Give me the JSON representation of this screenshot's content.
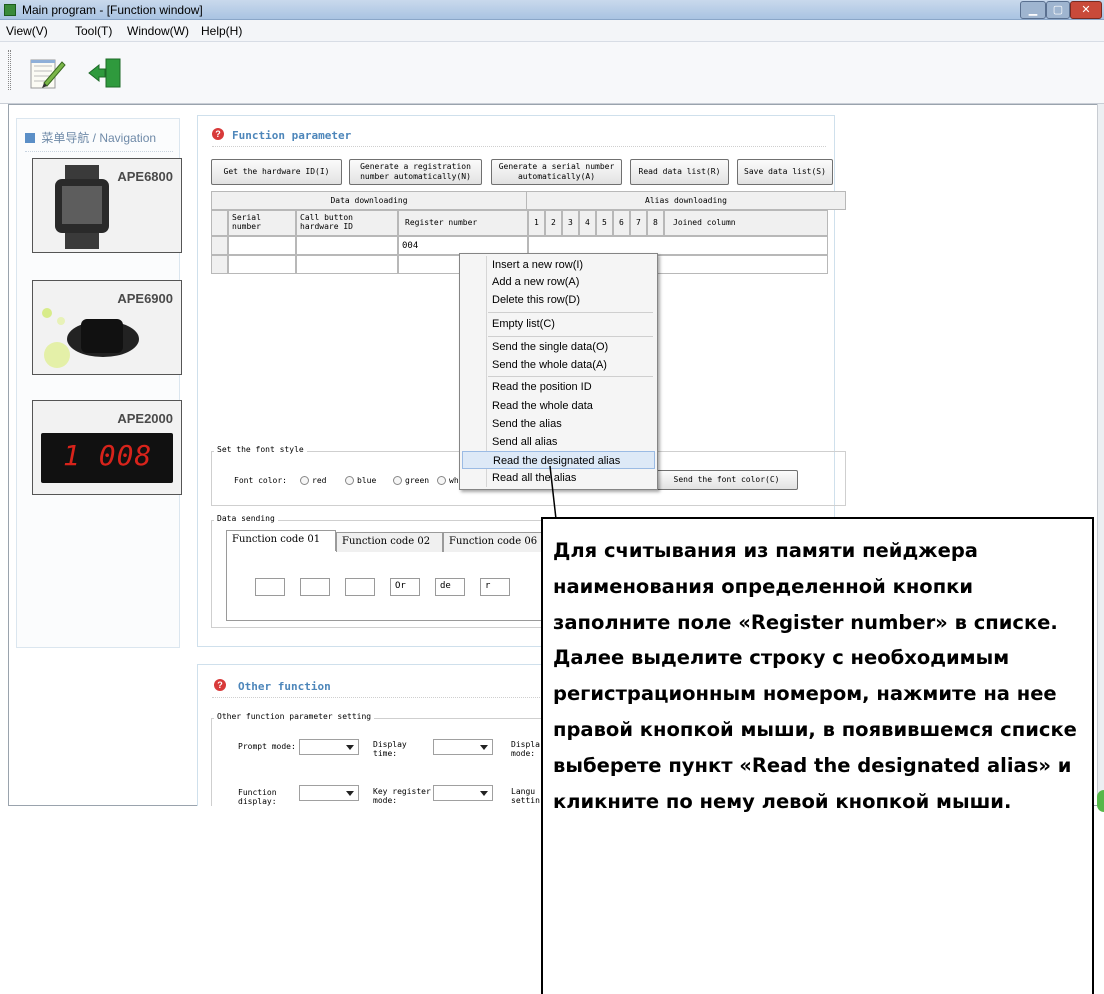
{
  "window": {
    "title": "Main program - [Function window]"
  },
  "menu": [
    "View(V)",
    "Tool(T)",
    "Window(W)",
    "Help(H)"
  ],
  "navigation": {
    "header": "菜单导航 / Navigation",
    "devices": [
      "APE6800",
      "APE6900",
      "APE2000"
    ],
    "pager_display": "1 008"
  },
  "function_parameter": {
    "title": "Function parameter",
    "buttons": {
      "get_hw_id": "Get the hardware ID(I)",
      "gen_reg": "Generate a registration number automatically(N)",
      "gen_serial": "Generate a serial number automatically(A)",
      "read_list": "Read data list(R)",
      "save_list": "Save data list(S)"
    },
    "group_headers": {
      "data": "Data downloading",
      "alias": "Alias downloading"
    },
    "columns": [
      "Serial number",
      "Call button hardware ID",
      "Register number",
      "1",
      "2",
      "3",
      "4",
      "5",
      "6",
      "7",
      "8",
      "Joined column"
    ],
    "rows": [
      {
        "register_number": "004"
      }
    ]
  },
  "context_menu": {
    "items": [
      "Insert a new row(I)",
      "Add a new row(A)",
      "Delete this row(D)",
      "Empty list(C)",
      "Send the single data(O)",
      "Send the whole data(A)",
      "Read the position ID",
      "Read the whole data",
      "Send the alias",
      "Send all alias",
      "Read the designated alias",
      "Read all the alias"
    ],
    "highlighted": "Read the designated alias"
  },
  "font_style": {
    "legend": "Set the font style",
    "label": "Font color:",
    "options": [
      "red",
      "blue",
      "green",
      "wh"
    ],
    "send_button": "Send the font color(C)"
  },
  "data_sending": {
    "legend": "Data sending",
    "tabs": [
      "Function code 01",
      "Function code 02",
      "Function code 06"
    ],
    "fields": [
      "",
      "",
      "",
      "Or",
      "de",
      "r"
    ]
  },
  "other_function": {
    "title": "Other function",
    "legend": "Other function parameter setting",
    "labels": [
      "Prompt mode:",
      "Display time:",
      "Displa mode:",
      "Function display:",
      "Key register mode:",
      "Langu settin"
    ]
  },
  "callout": {
    "text": "Для считывания из памяти пейджера наименования определенной кнопки заполните поле «Register number» в списке. Далее выделите строку с необходимым регистрационным номером, нажмите на нее правой кнопкой мыши, в появившемся списке выберете пункт «Read the designated alias» и кликните по нему левой кнопкой мыши."
  },
  "colors": {
    "panel_title": "#4d86ba",
    "highlight": "#dde9f7",
    "titlebar": "#b5cbe6",
    "close_button": "#c94a3a"
  }
}
